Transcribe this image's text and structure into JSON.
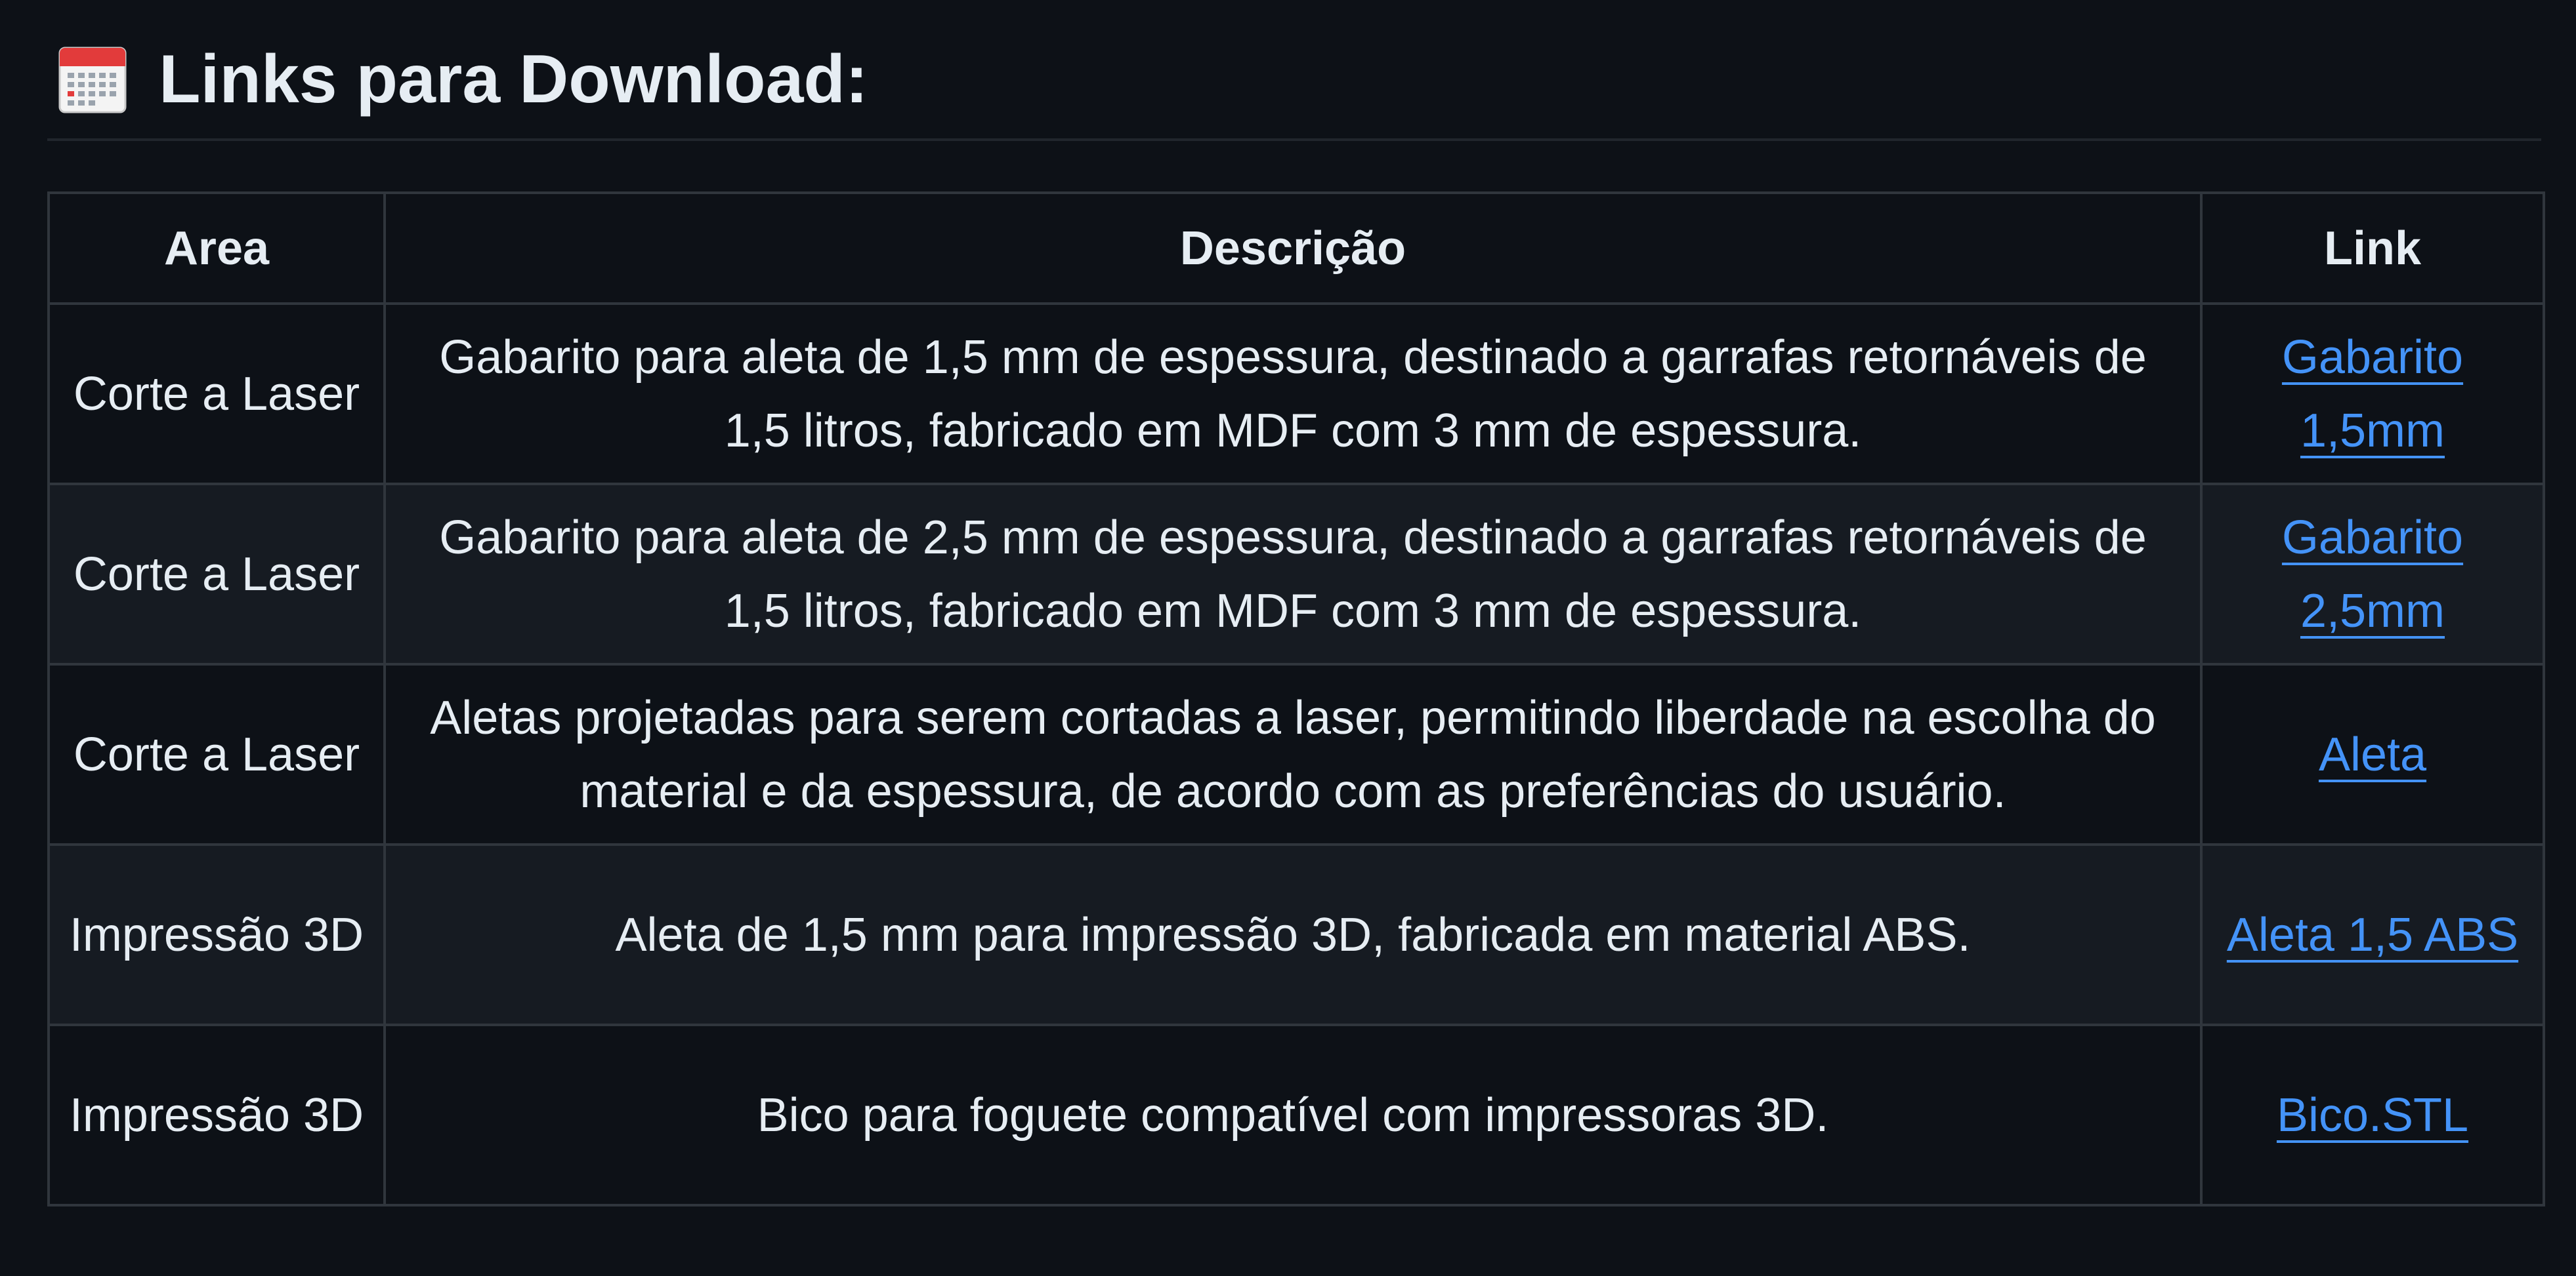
{
  "heading": {
    "icon": "calendar-icon",
    "title": "Links para Download:"
  },
  "table": {
    "headers": [
      "Area",
      "Descrição",
      "Link"
    ],
    "rows": [
      {
        "area": "Corte a Laser",
        "description": "Gabarito para aleta de 1,5 mm de espessura, destinado a garrafas retornáveis de 1,5 litros, fabricado em MDF com 3 mm de espessura.",
        "link": "Gabarito 1,5mm"
      },
      {
        "area": "Corte a Laser",
        "description": "Gabarito para aleta de 2,5 mm de espessura, destinado a garrafas retornáveis de 1,5 litros, fabricado em MDF com 3 mm de espessura.",
        "link": "Gabarito 2,5mm"
      },
      {
        "area": "Corte a Laser",
        "description": "Aletas projetadas para serem cortadas a laser, permitindo liberdade na escolha do material e da espessura, de acordo com as preferências do usuário.",
        "link": "Aleta"
      },
      {
        "area": "Impressão 3D",
        "description": "Aleta de 1,5 mm para impressão 3D, fabricada em material ABS.",
        "link": "Aleta 1,5 ABS"
      },
      {
        "area": "Impressão 3D",
        "description": "Bico para foguete compatível com impressoras 3D.",
        "link": "Bico.STL"
      }
    ]
  },
  "colors": {
    "background": "#0d1117",
    "row_alt": "#161b22",
    "border": "#30363d",
    "text": "#e6edf3",
    "link": "#4493f8"
  }
}
